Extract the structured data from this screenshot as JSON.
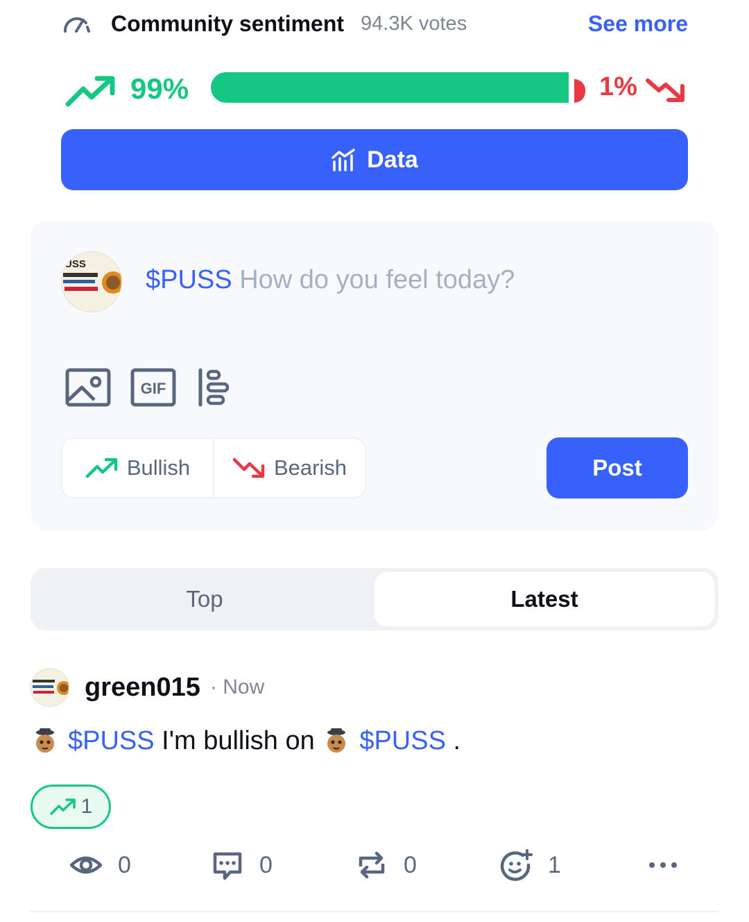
{
  "sentiment": {
    "title": "Community sentiment",
    "votes": "94.3K votes",
    "see_more": "See more",
    "bullish_pct_label": "99%",
    "bearish_pct_label": "1%",
    "bullish_fraction": 0.99,
    "data_button": "Data",
    "colors": {
      "bullish": "#16c784",
      "bearish": "#ea3943",
      "accent": "#3861fb"
    }
  },
  "composer": {
    "ticker": "$PUSS",
    "placeholder": "How do you feel today?",
    "tools": [
      "image-icon",
      "gif-icon",
      "poll-icon"
    ],
    "gif_label": "GIF",
    "avatar_text": "USS",
    "bullish_label": "Bullish",
    "bearish_label": "Bearish",
    "post_label": "Post"
  },
  "tabs": [
    {
      "label": "Top",
      "active": false
    },
    {
      "label": "Latest",
      "active": true
    }
  ],
  "post": {
    "username": "green015",
    "time": "· Now",
    "ticker": "$PUSS",
    "text_middle": " I'm bullish on ",
    "text_end": " .",
    "bullish_count": "1",
    "stats": {
      "views": "0",
      "comments": "0",
      "reposts": "0",
      "reactions": "1"
    }
  }
}
